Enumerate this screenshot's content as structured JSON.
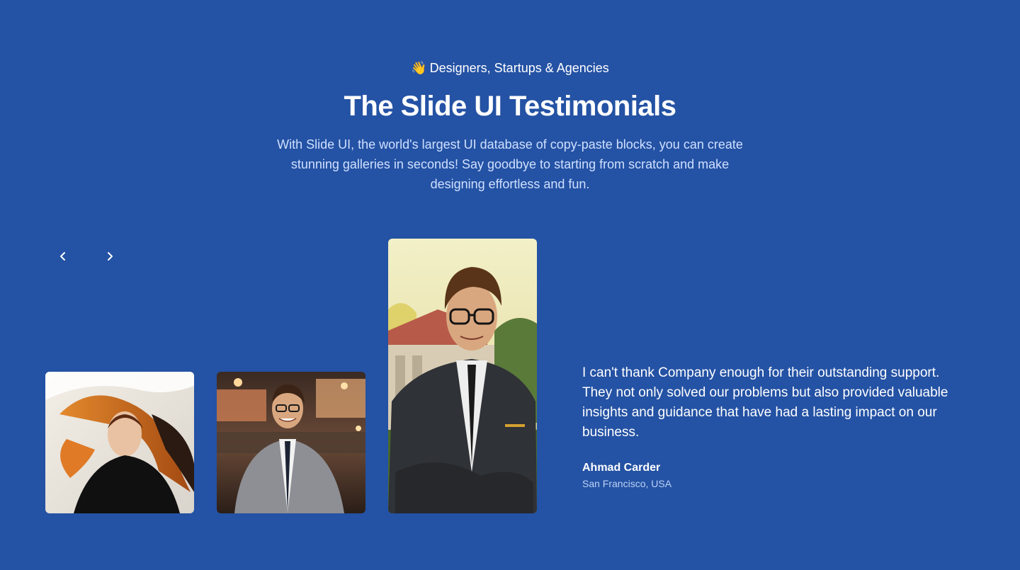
{
  "header": {
    "eyebrow_emoji": "👋",
    "eyebrow": "Designers, Startups & Agencies",
    "title": "The Slide UI Testimonials",
    "lead": "With Slide UI, the world's largest UI database of copy-paste blocks, you can create stunning galleries in seconds! Say goodbye to starting from scratch and make designing effortless and fun."
  },
  "carousel": {
    "prev_icon": "chevron-left-icon",
    "next_icon": "chevron-right-icon",
    "active_index": 2
  },
  "testimonial": {
    "quote": "I can't thank Company enough for their outstanding support. They not only solved our problems but also provided valuable insights and guidance that have had a lasting impact on our business.",
    "author": "Ahmad Carder",
    "location": "San Francisco, USA"
  },
  "colors": {
    "background": "#2452a4",
    "text": "#ffffff",
    "muted_text": "#cfe0ff"
  }
}
